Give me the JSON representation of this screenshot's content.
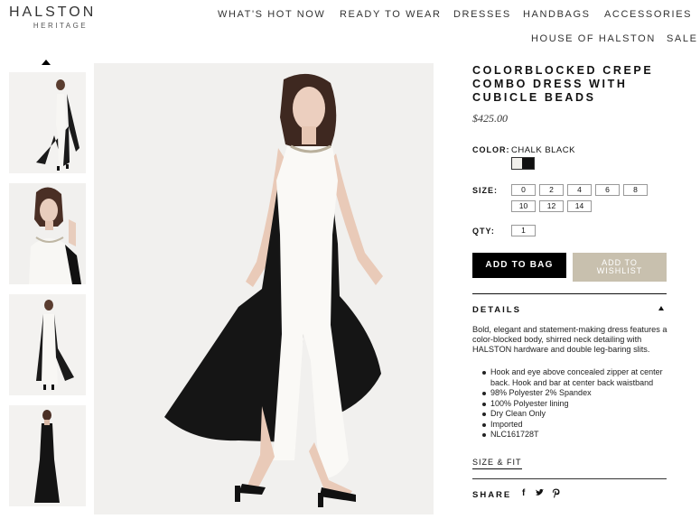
{
  "logo": {
    "brand": "HALSTON",
    "sub": "HERITAGE"
  },
  "nav": {
    "row1": [
      "WHAT'S HOT NOW",
      "READY TO WEAR",
      "DRESSES",
      "HANDBAGS",
      "ACCESSORIES"
    ],
    "row2": [
      "HOUSE OF HALSTON",
      "SALE"
    ]
  },
  "product": {
    "title_lines": [
      "COLORBLOCKED CREPE",
      "COMBO DRESS WITH",
      "CUBICLE BEADS"
    ],
    "price": "$425.00",
    "color_label": "COLOR:",
    "color_value": "CHALK BLACK",
    "size_label": "SIZE:",
    "sizes": [
      "0",
      "2",
      "4",
      "6",
      "8",
      "10",
      "12",
      "14"
    ],
    "qty_label": "QTY:",
    "qty_value": "1",
    "add_to_bag": "ADD TO BAG",
    "add_to_wishlist_lines": [
      "ADD TO",
      "WISHLIST"
    ],
    "details_heading": "DETAILS",
    "description": "Bold, elegant and statement-making dress features a color-blocked body, shirred neck detailing with HALSTON hardware and double leg-baring slits.",
    "bullets": [
      "Hook and eye above concealed zipper at center back. Hook and bar at center back waistband",
      "98% Polyester 2% Spandex",
      "100% Polyester lining",
      "Dry Clean Only",
      "Imported",
      "NLC161728T"
    ],
    "size_fit": "SIZE & FIT",
    "share": "SHARE",
    "social_icons": [
      "facebook-icon",
      "twitter-icon",
      "pinterest-icon"
    ]
  },
  "colors": {
    "black": "#111111",
    "chalk": "#f2f0ec",
    "wishlist": "#c8c0ae",
    "image_bg": "#f1f0ee"
  }
}
